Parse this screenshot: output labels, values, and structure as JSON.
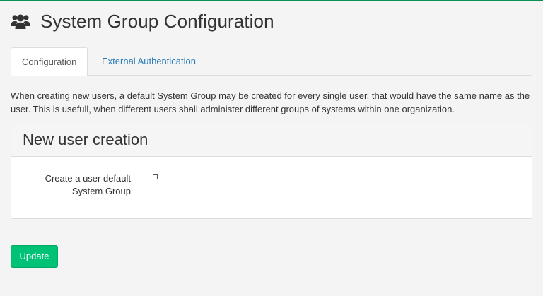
{
  "page": {
    "title": "System Group Configuration",
    "title_icon": "users-icon"
  },
  "tabs": [
    {
      "label": "Configuration",
      "active": true
    },
    {
      "label": "External Authentication",
      "active": false
    }
  ],
  "description": "When creating new users, a default System Group may be created for every single user, that would have the same name as the user. This is usefull, when different users shall administer different groups of systems within one organization.",
  "panel": {
    "heading": "New user creation",
    "field_label": "Create a user default System Group",
    "checked": false
  },
  "actions": {
    "update_label": "Update"
  },
  "colors": {
    "accent": "#00c277",
    "link": "#2a7ab8",
    "top_border": "#0a8f59"
  }
}
